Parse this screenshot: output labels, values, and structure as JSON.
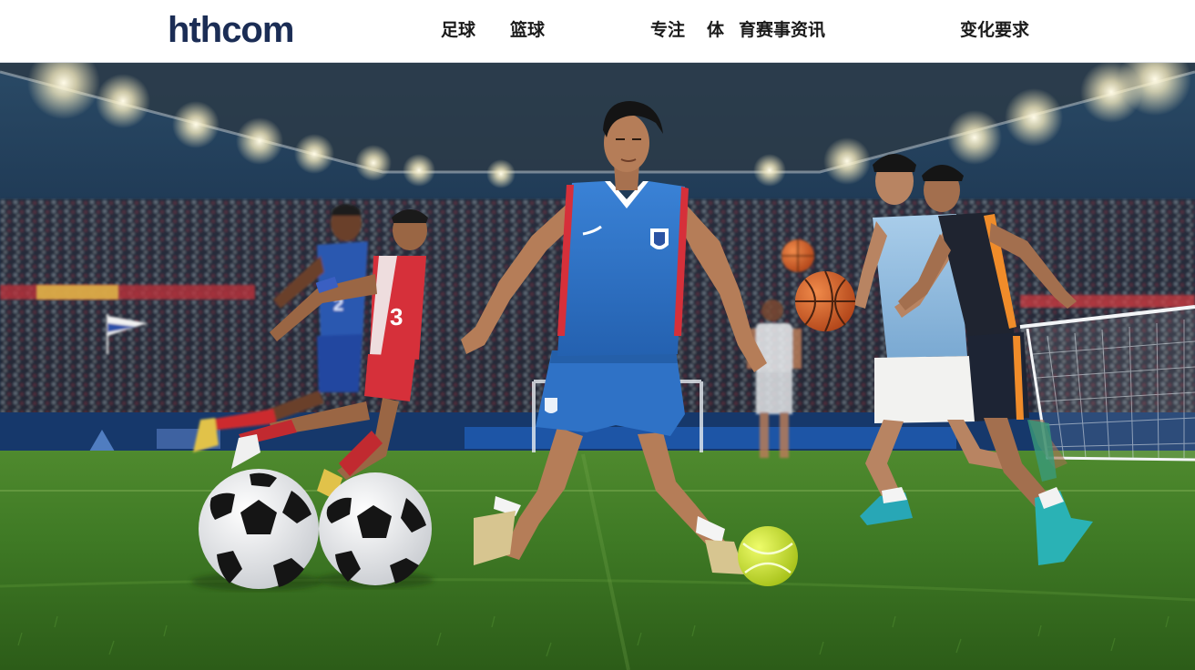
{
  "header": {
    "logo_text": "hthcom",
    "nav": [
      {
        "label": "足球"
      },
      {
        "label": "篮球"
      },
      {
        "label": "专注"
      },
      {
        "label": "体"
      },
      {
        "label": "育赛事资讯"
      },
      {
        "label": "变化要求"
      }
    ]
  },
  "hero": {
    "jersey_number_left": "3",
    "jersey_number_far": "2"
  },
  "colors": {
    "logo": "#1b2d55",
    "nav_text": "#1a1a1a",
    "pitch_green": "#3f7a25",
    "jersey_blue": "#2f72c6",
    "jersey_red": "#d6303a"
  }
}
